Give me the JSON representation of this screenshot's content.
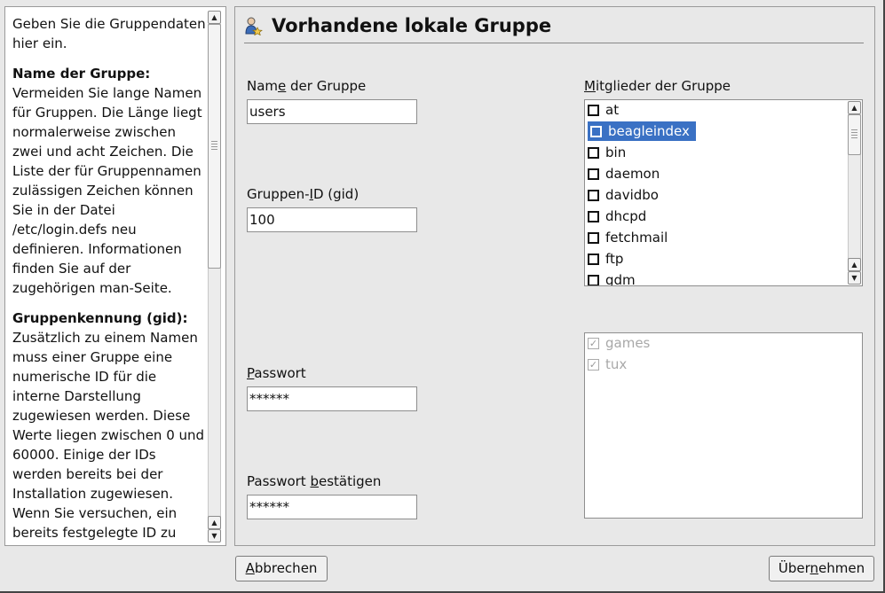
{
  "help": {
    "intro": "Geben Sie die Gruppendaten hier ein.",
    "section1_heading": "Name der Gruppe:",
    "section1_body": "Vermeiden Sie lange Namen für Gruppen. Die Länge liegt normalerweise zwischen zwei und acht Zeichen. Die Liste der für Gruppennamen zulässigen Zeichen können Sie in der Datei /etc/login.defs neu definieren. Informationen finden Sie auf der zugehörigen man-Seite.",
    "section2_heading": "Gruppenkennung (gid):",
    "section2_body": "Zusätzlich zu einem Namen muss einer Gruppe eine numerische ID für die interne Darstellung zugewiesen werden. Diese Werte liegen zwischen 0 und 60000. Einige der IDs werden bereits bei der Installation zugewiesen. Wenn Sie versuchen, ein bereits festgelegte ID zu verwenden, wird eine Warnung ausgegeben."
  },
  "header": {
    "title": "Vorhandene lokale Gruppe",
    "icon": "group-user-icon"
  },
  "form": {
    "name_label_pre": "Nam",
    "name_label_mn": "e",
    "name_label_post": " der Gruppe",
    "name_value": "users",
    "gid_label_pre": "Gruppen-",
    "gid_label_mn": "I",
    "gid_label_post": "D (gid)",
    "gid_value": "100",
    "password_label_mn": "P",
    "password_label_post": "asswort",
    "password_value": "******",
    "confirm_label_pre": "Passwort ",
    "confirm_label_mn": "b",
    "confirm_label_post": "estätigen",
    "confirm_value": "******"
  },
  "members": {
    "label_mn": "M",
    "label_post": "itglieder der Gruppe",
    "items": [
      {
        "name": "at",
        "checked": false,
        "selected": false
      },
      {
        "name": "beagleindex",
        "checked": false,
        "selected": true
      },
      {
        "name": "bin",
        "checked": false,
        "selected": false
      },
      {
        "name": "daemon",
        "checked": false,
        "selected": false
      },
      {
        "name": "davidbo",
        "checked": false,
        "selected": false
      },
      {
        "name": "dhcpd",
        "checked": false,
        "selected": false
      },
      {
        "name": "fetchmail",
        "checked": false,
        "selected": false
      },
      {
        "name": "ftp",
        "checked": false,
        "selected": false
      },
      {
        "name": "gdm",
        "checked": false,
        "selected": false
      }
    ],
    "default_items": [
      {
        "name": "games",
        "checked": true
      },
      {
        "name": "tux",
        "checked": true
      }
    ]
  },
  "buttons": {
    "cancel_mn": "A",
    "cancel_post": "bbrechen",
    "accept_pre": "Über",
    "accept_mn": "n",
    "accept_post": "ehmen"
  },
  "colors": {
    "selection": "#3a71c4",
    "background": "#e8e8e8"
  }
}
